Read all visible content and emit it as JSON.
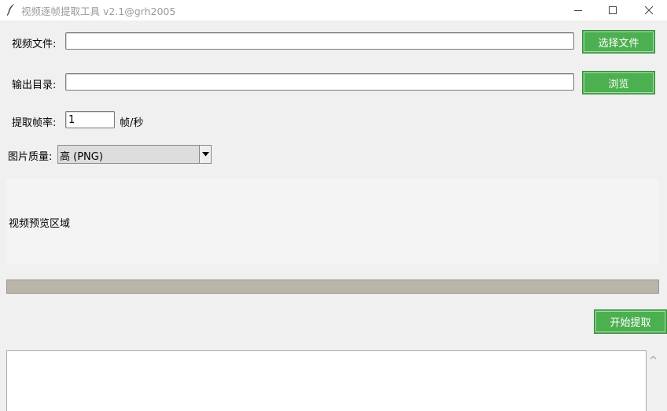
{
  "window": {
    "title": "视频逐帧提取工具 v2.1@grh2005"
  },
  "form": {
    "video_file_label": "视频文件:",
    "video_file_value": "",
    "choose_file_button": "选择文件",
    "output_dir_label": "输出目录:",
    "output_dir_value": "",
    "browse_button": "浏览",
    "frame_rate_label": "提取帧率:",
    "frame_rate_value": "1",
    "frame_rate_unit": "帧/秒",
    "quality_label": "图片质量:",
    "quality_selected": "高 (PNG)"
  },
  "preview": {
    "placeholder": "视频预览区域"
  },
  "progress": {
    "value_percent": 0
  },
  "actions": {
    "start_button": "开始提取"
  },
  "log": {
    "content": ""
  },
  "colors": {
    "accent_button": "#4caf50",
    "progress_trough": "#bab5aa"
  }
}
